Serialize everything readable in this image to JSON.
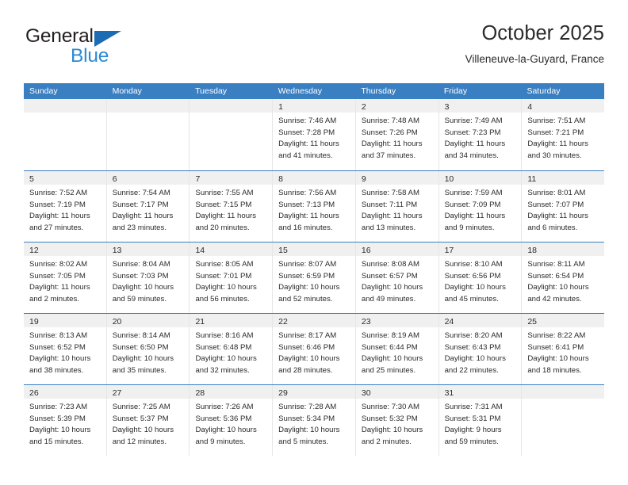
{
  "brand": {
    "name_dark": "General",
    "name_blue": "Blue",
    "triangle_color": "#1b6cb5",
    "blue_color": "#2b8ad6"
  },
  "header": {
    "title": "October 2025",
    "subtitle": "Villeneuve-la-Guyard, France",
    "header_bg": "#3a7fc1",
    "daynum_bg": "#f0f0f0"
  },
  "weekdays": [
    "Sunday",
    "Monday",
    "Tuesday",
    "Wednesday",
    "Thursday",
    "Friday",
    "Saturday"
  ],
  "labels": {
    "sunrise": "Sunrise:",
    "sunset": "Sunset:",
    "daylight": "Daylight:"
  },
  "weeks": [
    [
      {
        "day": "",
        "lines": []
      },
      {
        "day": "",
        "lines": []
      },
      {
        "day": "",
        "lines": []
      },
      {
        "day": "1",
        "lines": [
          "Sunrise: 7:46 AM",
          "Sunset: 7:28 PM",
          "Daylight: 11 hours",
          "and 41 minutes."
        ]
      },
      {
        "day": "2",
        "lines": [
          "Sunrise: 7:48 AM",
          "Sunset: 7:26 PM",
          "Daylight: 11 hours",
          "and 37 minutes."
        ]
      },
      {
        "day": "3",
        "lines": [
          "Sunrise: 7:49 AM",
          "Sunset: 7:23 PM",
          "Daylight: 11 hours",
          "and 34 minutes."
        ]
      },
      {
        "day": "4",
        "lines": [
          "Sunrise: 7:51 AM",
          "Sunset: 7:21 PM",
          "Daylight: 11 hours",
          "and 30 minutes."
        ]
      }
    ],
    [
      {
        "day": "5",
        "lines": [
          "Sunrise: 7:52 AM",
          "Sunset: 7:19 PM",
          "Daylight: 11 hours",
          "and 27 minutes."
        ]
      },
      {
        "day": "6",
        "lines": [
          "Sunrise: 7:54 AM",
          "Sunset: 7:17 PM",
          "Daylight: 11 hours",
          "and 23 minutes."
        ]
      },
      {
        "day": "7",
        "lines": [
          "Sunrise: 7:55 AM",
          "Sunset: 7:15 PM",
          "Daylight: 11 hours",
          "and 20 minutes."
        ]
      },
      {
        "day": "8",
        "lines": [
          "Sunrise: 7:56 AM",
          "Sunset: 7:13 PM",
          "Daylight: 11 hours",
          "and 16 minutes."
        ]
      },
      {
        "day": "9",
        "lines": [
          "Sunrise: 7:58 AM",
          "Sunset: 7:11 PM",
          "Daylight: 11 hours",
          "and 13 minutes."
        ]
      },
      {
        "day": "10",
        "lines": [
          "Sunrise: 7:59 AM",
          "Sunset: 7:09 PM",
          "Daylight: 11 hours",
          "and 9 minutes."
        ]
      },
      {
        "day": "11",
        "lines": [
          "Sunrise: 8:01 AM",
          "Sunset: 7:07 PM",
          "Daylight: 11 hours",
          "and 6 minutes."
        ]
      }
    ],
    [
      {
        "day": "12",
        "lines": [
          "Sunrise: 8:02 AM",
          "Sunset: 7:05 PM",
          "Daylight: 11 hours",
          "and 2 minutes."
        ]
      },
      {
        "day": "13",
        "lines": [
          "Sunrise: 8:04 AM",
          "Sunset: 7:03 PM",
          "Daylight: 10 hours",
          "and 59 minutes."
        ]
      },
      {
        "day": "14",
        "lines": [
          "Sunrise: 8:05 AM",
          "Sunset: 7:01 PM",
          "Daylight: 10 hours",
          "and 56 minutes."
        ]
      },
      {
        "day": "15",
        "lines": [
          "Sunrise: 8:07 AM",
          "Sunset: 6:59 PM",
          "Daylight: 10 hours",
          "and 52 minutes."
        ]
      },
      {
        "day": "16",
        "lines": [
          "Sunrise: 8:08 AM",
          "Sunset: 6:57 PM",
          "Daylight: 10 hours",
          "and 49 minutes."
        ]
      },
      {
        "day": "17",
        "lines": [
          "Sunrise: 8:10 AM",
          "Sunset: 6:56 PM",
          "Daylight: 10 hours",
          "and 45 minutes."
        ]
      },
      {
        "day": "18",
        "lines": [
          "Sunrise: 8:11 AM",
          "Sunset: 6:54 PM",
          "Daylight: 10 hours",
          "and 42 minutes."
        ]
      }
    ],
    [
      {
        "day": "19",
        "lines": [
          "Sunrise: 8:13 AM",
          "Sunset: 6:52 PM",
          "Daylight: 10 hours",
          "and 38 minutes."
        ]
      },
      {
        "day": "20",
        "lines": [
          "Sunrise: 8:14 AM",
          "Sunset: 6:50 PM",
          "Daylight: 10 hours",
          "and 35 minutes."
        ]
      },
      {
        "day": "21",
        "lines": [
          "Sunrise: 8:16 AM",
          "Sunset: 6:48 PM",
          "Daylight: 10 hours",
          "and 32 minutes."
        ]
      },
      {
        "day": "22",
        "lines": [
          "Sunrise: 8:17 AM",
          "Sunset: 6:46 PM",
          "Daylight: 10 hours",
          "and 28 minutes."
        ]
      },
      {
        "day": "23",
        "lines": [
          "Sunrise: 8:19 AM",
          "Sunset: 6:44 PM",
          "Daylight: 10 hours",
          "and 25 minutes."
        ]
      },
      {
        "day": "24",
        "lines": [
          "Sunrise: 8:20 AM",
          "Sunset: 6:43 PM",
          "Daylight: 10 hours",
          "and 22 minutes."
        ]
      },
      {
        "day": "25",
        "lines": [
          "Sunrise: 8:22 AM",
          "Sunset: 6:41 PM",
          "Daylight: 10 hours",
          "and 18 minutes."
        ]
      }
    ],
    [
      {
        "day": "26",
        "lines": [
          "Sunrise: 7:23 AM",
          "Sunset: 5:39 PM",
          "Daylight: 10 hours",
          "and 15 minutes."
        ]
      },
      {
        "day": "27",
        "lines": [
          "Sunrise: 7:25 AM",
          "Sunset: 5:37 PM",
          "Daylight: 10 hours",
          "and 12 minutes."
        ]
      },
      {
        "day": "28",
        "lines": [
          "Sunrise: 7:26 AM",
          "Sunset: 5:36 PM",
          "Daylight: 10 hours",
          "and 9 minutes."
        ]
      },
      {
        "day": "29",
        "lines": [
          "Sunrise: 7:28 AM",
          "Sunset: 5:34 PM",
          "Daylight: 10 hours",
          "and 5 minutes."
        ]
      },
      {
        "day": "30",
        "lines": [
          "Sunrise: 7:30 AM",
          "Sunset: 5:32 PM",
          "Daylight: 10 hours",
          "and 2 minutes."
        ]
      },
      {
        "day": "31",
        "lines": [
          "Sunrise: 7:31 AM",
          "Sunset: 5:31 PM",
          "Daylight: 9 hours",
          "and 59 minutes."
        ]
      },
      {
        "day": "",
        "lines": []
      }
    ]
  ]
}
